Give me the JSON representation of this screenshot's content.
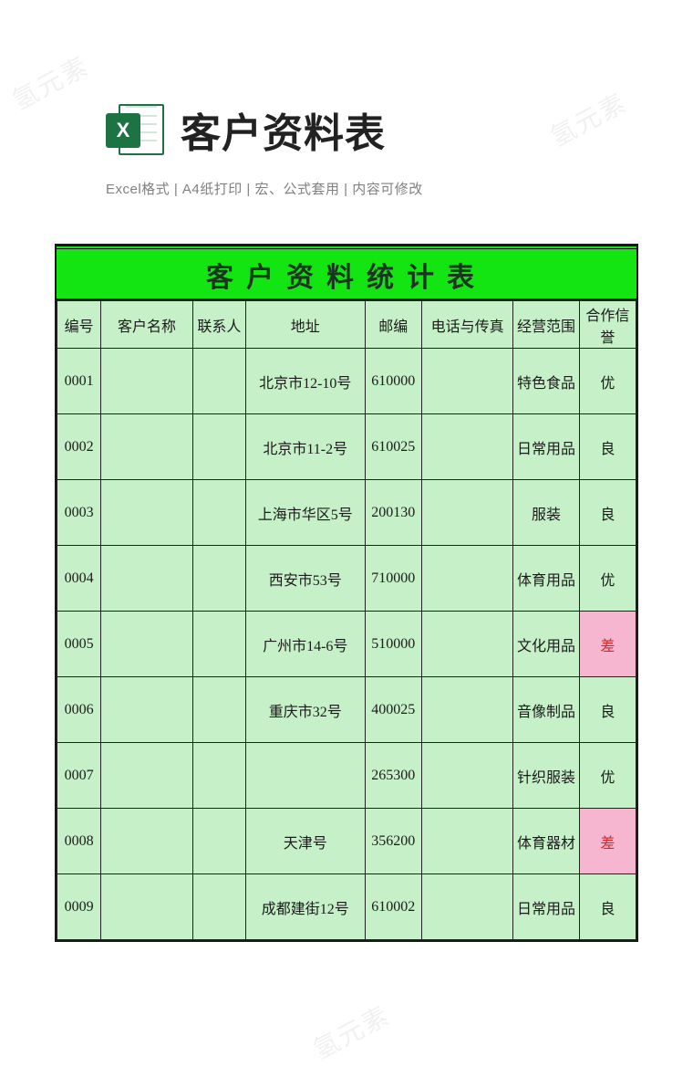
{
  "watermark_text": "氢元素",
  "header": {
    "icon_letter": "X",
    "title": "客户资料表",
    "subtitle": "Excel格式 |  A4纸打印 | 宏、公式套用 | 内容可修改"
  },
  "sheet": {
    "title": "客户资料统计表",
    "columns": [
      "编号",
      "客户名称",
      "联系人",
      "地址",
      "邮编",
      "电话与传真",
      "经营范围",
      "合作信誉"
    ],
    "rows": [
      {
        "id": "0001",
        "name": "",
        "contact": "",
        "address": "北京市12-10号",
        "zip": "610000",
        "tel": "",
        "scope": "特色食品",
        "credit": "优",
        "credit_flag": false
      },
      {
        "id": "0002",
        "name": "",
        "contact": "",
        "address": "北京市11-2号",
        "zip": "610025",
        "tel": "",
        "scope": "日常用品",
        "credit": "良",
        "credit_flag": false
      },
      {
        "id": "0003",
        "name": "",
        "contact": "",
        "address": "上海市华区5号",
        "zip": "200130",
        "tel": "",
        "scope": "服装",
        "credit": "良",
        "credit_flag": false
      },
      {
        "id": "0004",
        "name": "",
        "contact": "",
        "address": "西安市53号",
        "zip": "710000",
        "tel": "",
        "scope": "体育用品",
        "credit": "优",
        "credit_flag": false
      },
      {
        "id": "0005",
        "name": "",
        "contact": "",
        "address": "广州市14-6号",
        "zip": "510000",
        "tel": "",
        "scope": "文化用品",
        "credit": "差",
        "credit_flag": true
      },
      {
        "id": "0006",
        "name": "",
        "contact": "",
        "address": "重庆市32号",
        "zip": "400025",
        "tel": "",
        "scope": "音像制品",
        "credit": "良",
        "credit_flag": false
      },
      {
        "id": "0007",
        "name": "",
        "contact": "",
        "address": "",
        "zip": "265300",
        "tel": "",
        "scope": "针织服装",
        "credit": "优",
        "credit_flag": false
      },
      {
        "id": "0008",
        "name": "",
        "contact": "",
        "address": "天津号",
        "zip": "356200",
        "tel": "",
        "scope": "体育器材",
        "credit": "差",
        "credit_flag": true
      },
      {
        "id": "0009",
        "name": "",
        "contact": "",
        "address": "成都建街12号",
        "zip": "610002",
        "tel": "",
        "scope": "日常用品",
        "credit": "良",
        "credit_flag": false
      }
    ]
  }
}
